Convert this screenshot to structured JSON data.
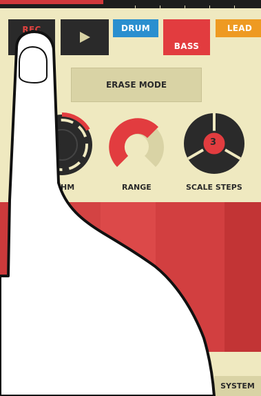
{
  "transport": {
    "rec_label": "REC",
    "play_icon": "play-icon"
  },
  "instruments": {
    "drum_label": "DRUM",
    "bass_label": "BASS",
    "lead_label": "LEAD"
  },
  "mode": {
    "erase_label": "ERASE MODE"
  },
  "knobs": {
    "rhythm_label_visible": "HM",
    "range_label": "RANGE",
    "scale_steps_label": "SCALE STEPS",
    "scale_steps_value": "3"
  },
  "footer": {
    "system_label": "SYSTEM"
  },
  "colors": {
    "background": "#efe9c0",
    "dark": "#2a2a2a",
    "red": "#e23c3f",
    "blue": "#2a8fcf",
    "orange": "#ee9a22",
    "beige": "#d9d3a5"
  }
}
